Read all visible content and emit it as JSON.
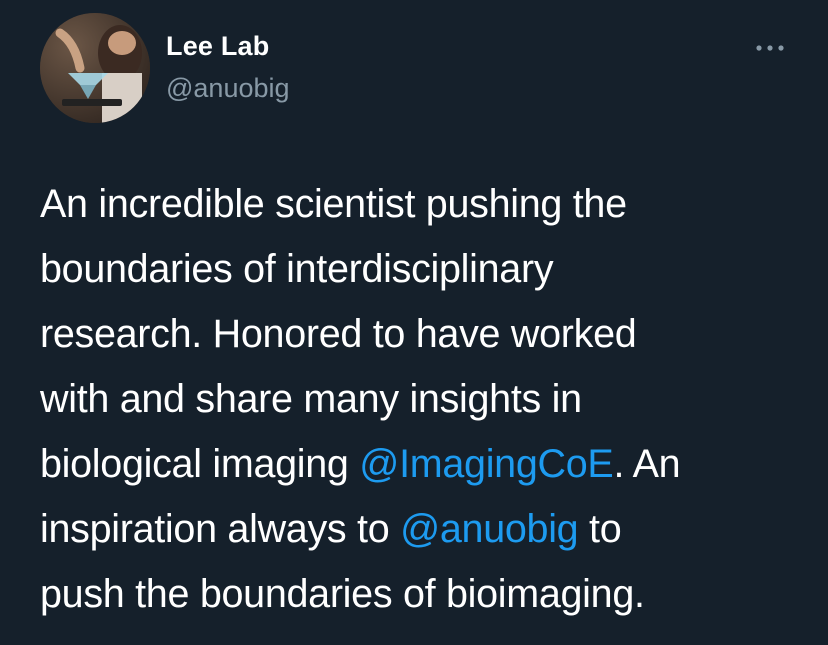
{
  "author": {
    "display_name": "Lee Lab",
    "handle": "@anuobig",
    "avatar_icon": "profile-photo"
  },
  "more_icon": "more-horizontal-icon",
  "colors": {
    "background": "#15202b",
    "text": "#ffffff",
    "secondary_text": "#8899a6",
    "link": "#1d9bf0"
  },
  "tweet": {
    "lines": [
      [
        {
          "text": "An incredible scientist pushing the"
        }
      ],
      [
        {
          "text": "boundaries of interdisciplinary"
        }
      ],
      [
        {
          "text": "research. Honored to have worked"
        }
      ],
      [
        {
          "text": "with and share many insights in"
        }
      ],
      [
        {
          "text": "biological imaging "
        },
        {
          "text": "@ImagingCoE",
          "mention": true
        },
        {
          "text": ". An"
        }
      ],
      [
        {
          "text": "inspiration always to "
        },
        {
          "text": "@anuobig",
          "mention": true
        },
        {
          "text": " to"
        }
      ],
      [
        {
          "text": "push the boundaries of bioimaging."
        }
      ]
    ]
  }
}
